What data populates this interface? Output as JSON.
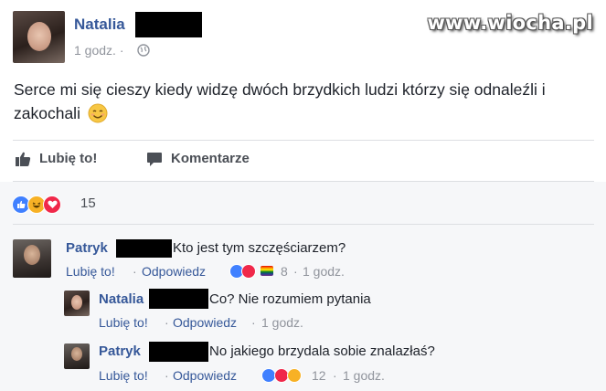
{
  "watermark": "www.wiocha.pl",
  "post": {
    "author": "Natalia",
    "time": "1 godz.",
    "privacy_separator": "·",
    "text": "Serce mi się cieszy kiedy widzę dwóch brzydkich ludzi którzy się odnaleźli i zakochali",
    "emoji": "smiling-face"
  },
  "actions": {
    "like": "Lubię to!",
    "comment": "Komentarze"
  },
  "reactions_summary": {
    "types": [
      "like",
      "haha",
      "love"
    ],
    "count": "15"
  },
  "comments": [
    {
      "author": "Patryk",
      "text": "Kto jest tym szczęściarzem?",
      "like_label": "Lubię to!",
      "reply_label": "Odpowiedz",
      "reactions": [
        "like",
        "love",
        "rainbow"
      ],
      "reaction_count": "8",
      "time": "1 godz.",
      "sep": "·"
    },
    {
      "author": "Natalia",
      "text": "Co? Nie rozumiem pytania",
      "like_label": "Lubię to!",
      "reply_label": "Odpowiedz",
      "time": "1 godz.",
      "sep": "·"
    },
    {
      "author": "Patryk",
      "text": "No jakiego brzydala sobie znalazłaś?",
      "like_label": "Lubię to!",
      "reply_label": "Odpowiedz",
      "reactions": [
        "like",
        "love",
        "haha"
      ],
      "reaction_count": "12",
      "time": "1 godz.",
      "sep": "·"
    }
  ],
  "colors": {
    "name_blue": "#365899",
    "meta_gray": "#90949c",
    "divider": "#dddfe2",
    "like_blue": "#4080ff",
    "love_red": "#f0284a",
    "haha_yellow": "#f7b125"
  }
}
